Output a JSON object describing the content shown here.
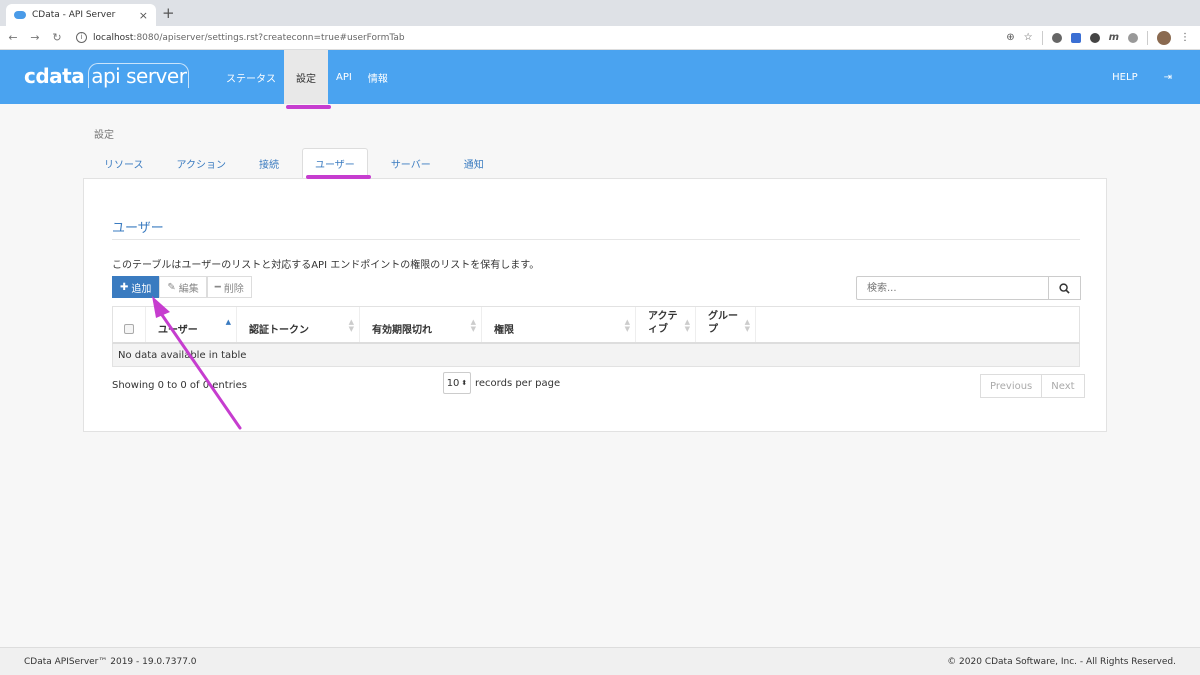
{
  "browser": {
    "tab_title": "CData - API Server",
    "tab_close": "×",
    "new_tab": "+",
    "url_host": "localhost",
    "url_path": ":8080/apiserver/settings.rst?createconn=true#userFormTab",
    "m_ext": "m"
  },
  "app": {
    "logo_cdata": "cdata",
    "logo_product": "api server",
    "nav": [
      "ステータス",
      "設定",
      "API",
      "情報"
    ],
    "help": "HELP",
    "signout": "⇥"
  },
  "settings": {
    "breadcrumb": "設定",
    "tabs": [
      "リソース",
      "アクション",
      "接続",
      "ユーザー",
      "サーバー",
      "通知"
    ]
  },
  "users": {
    "title": "ユーザー",
    "description": "このテーブルはユーザーのリストと対応するAPI エンドポイントの権限のリストを保有します。",
    "add_label": "追加",
    "edit_label": "編集",
    "delete_label": "削除",
    "search_placeholder": "検索...",
    "columns": [
      "ユーザー",
      "認証トークン",
      "有効期限切れ",
      "権限",
      "アクティブ",
      "グループ"
    ],
    "empty_message": "No data available in table",
    "entries_info": "Showing 0 to 0 of 0 entries",
    "per_page_value": "10",
    "per_page_label": "records per page",
    "previous": "Previous",
    "next": "Next"
  },
  "footer": {
    "version": "CData APIServer™ 2019 - 19.0.7377.0",
    "copyright": "© 2020 CData Software, Inc. - All Rights Reserved."
  },
  "colors": {
    "header_blue": "#4aa3f0",
    "primary": "#3a7bc0",
    "highlight": "#c63dcf"
  }
}
